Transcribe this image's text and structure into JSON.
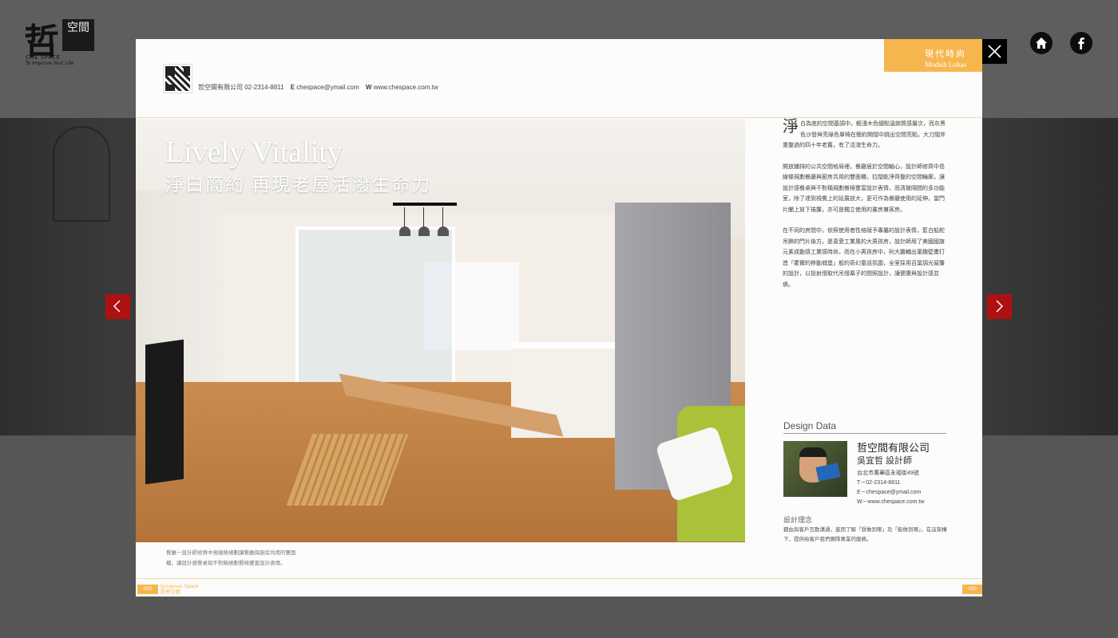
{
  "site": {
    "logo": {
      "glyph": "哲",
      "box_text": "空間",
      "name_en": "CHE SPACE",
      "tagline": "To Improve Your Life"
    },
    "icons": [
      "home-icon",
      "facebook-icon"
    ]
  },
  "magazine": {
    "contact": {
      "company": "哲空間有限公司",
      "phone": "02-2314-8811",
      "email_label": "E",
      "email": "chespace@ymail.com",
      "web_label": "W",
      "web": "www.chespace.com.tw"
    },
    "section_tab": {
      "zh": "現代時尚",
      "en": "Modish Lohas"
    },
    "hero": {
      "title_en": "Lively Vitality",
      "title_zh": "淨白簡約  再現老屋活潑生命力"
    },
    "body": {
      "drop_cap": "淨",
      "p1": "白為底的空間基調中，輕淺木色綴點溫婉質感層次，而灰黑色沙發與亮綠色單椅在簡約開闊中跳出空間亮點，大刀闊斧重整過的四十年老舊，有了活潑生命力。",
      "p2": "開放鋪排的公共空間格局裡，餐廳居於空間軸心，設計師修齊中島線條規劃餐廳與廚房共用的雙面櫃，拉闊乾淨齊整的空間輪廓，讓設計感餐桌與不對稱規劃餐椅豐富設計表情，而清玻隔間的多功能室，除了達到視覺上的延展放大，更可作為餐廳使用的延伸，當門片闔上放下捲簾，亦可是獨立使用的書房兼客房。",
      "p3": "在不同的房間中，依照使用者性格賦予專屬的設計表情，藍白船舵吊飾的門片後方，是喜愛工業風的大男孩房，設計師用了美國國旗元素成動感工業感時尚，而在小男孩房中，則大膽輔出童趣壁畫打造「霍爾的移動城堡」般的奇幻童話氛圍，全室採用百葉調光窗簾的設計，以投射燈取代吊燈幕子的間照設計，讓健康與設計感並俱。"
    },
    "design_data": {
      "title": "Design Data",
      "company": "哲空間有限公司",
      "designer": "吳宜哲  設計師",
      "address": "台北市萬華區永福街49號",
      "tel": "T－02-2314-8811",
      "email": "E－chespace@ymail.com",
      "web": "W－www.chespace.com.tw",
      "concept_heading": "設計理念",
      "concept": "藉由與客戶互動溝通，進而了解「想做到哪」及「能做到哪」，在這架構下，提供給客戶我們團隊專業的服務。"
    },
    "caption": "餐廳－設計師修齊中島線條規劃讓餐廳與廚房共用的雙面櫃，讓設計感餐桌與不對稱規劃餐椅豐富設計表情。",
    "footer": {
      "page_left": "000",
      "page_right": "000",
      "mag_en": "Gorgeous Space",
      "mag_zh": "漂亮空間"
    }
  },
  "controls": {
    "close": "close-icon",
    "prev": "chevron-left-icon",
    "next": "chevron-right-icon"
  }
}
